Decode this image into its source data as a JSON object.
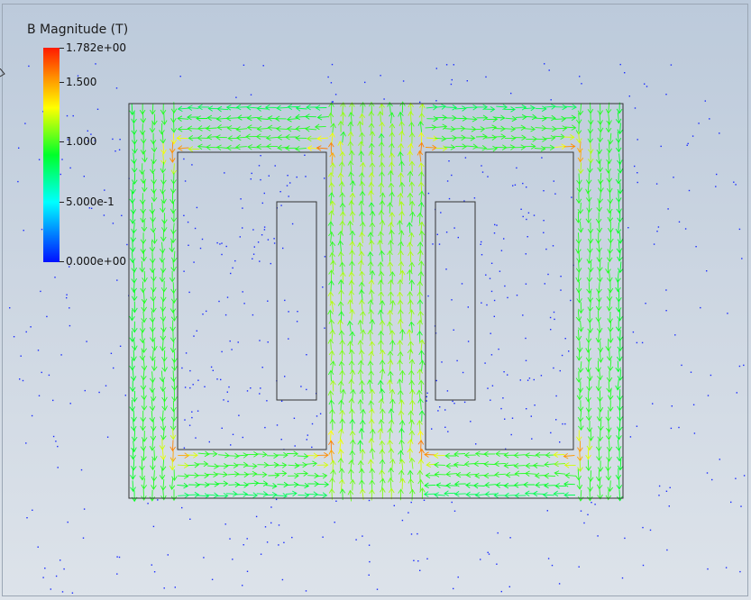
{
  "legend": {
    "title": "B Magnitude (T)",
    "ticks": [
      {
        "label": "1.782e+00",
        "value": 1.782
      },
      {
        "label": "1.500",
        "value": 1.5
      },
      {
        "label": "1.000",
        "value": 1.0
      },
      {
        "label": "5.000e-1",
        "value": 0.5
      },
      {
        "label": "0.000e+00",
        "value": 0.0
      }
    ],
    "range": [
      0,
      1.782
    ],
    "colormap": [
      "#0010ff",
      "#00ffff",
      "#00ff2a",
      "#ffff00",
      "#ff9900",
      "#ff1a00"
    ]
  },
  "colors": {
    "background_top": "#bccadb",
    "background_bottom": "#dde3ea",
    "outline": "#333333",
    "low_field_dots": "#1a2cff"
  }
}
